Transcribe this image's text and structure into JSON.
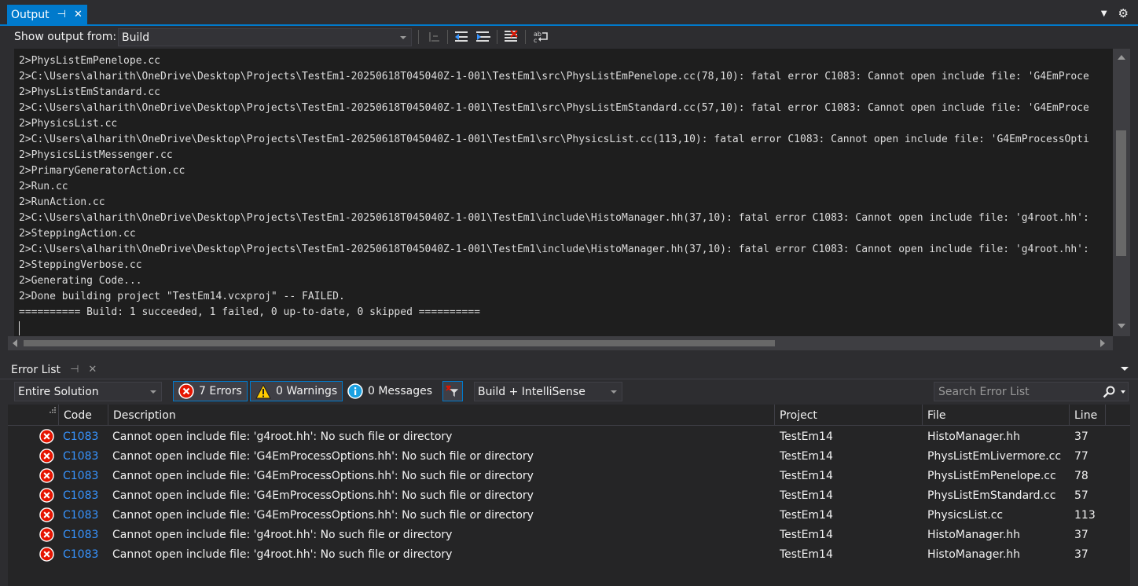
{
  "output": {
    "tab_title": "Output",
    "pin_glyph": "⊣",
    "close_glyph": "✕",
    "window_menu_glyph": "▼",
    "settings_glyph": "⚙",
    "show_output_label": "Show output from:",
    "source_value": "Build",
    "lines": [
      "2>PhysListEmPenelope.cc",
      "2>C:\\Users\\alharith\\OneDrive\\Desktop\\Projects\\TestEm1-20250618T045040Z-1-001\\TestEm1\\src\\PhysListEmPenelope.cc(78,10): fatal error C1083: Cannot open include file: 'G4EmProce",
      "2>PhysListEmStandard.cc",
      "2>C:\\Users\\alharith\\OneDrive\\Desktop\\Projects\\TestEm1-20250618T045040Z-1-001\\TestEm1\\src\\PhysListEmStandard.cc(57,10): fatal error C1083: Cannot open include file: 'G4EmProce",
      "2>PhysicsList.cc",
      "2>C:\\Users\\alharith\\OneDrive\\Desktop\\Projects\\TestEm1-20250618T045040Z-1-001\\TestEm1\\src\\PhysicsList.cc(113,10): fatal error C1083: Cannot open include file: 'G4EmProcessOpti",
      "2>PhysicsListMessenger.cc",
      "2>PrimaryGeneratorAction.cc",
      "2>Run.cc",
      "2>RunAction.cc",
      "2>C:\\Users\\alharith\\OneDrive\\Desktop\\Projects\\TestEm1-20250618T045040Z-1-001\\TestEm1\\include\\HistoManager.hh(37,10): fatal error C1083: Cannot open include file: 'g4root.hh':",
      "2>SteppingAction.cc",
      "2>C:\\Users\\alharith\\OneDrive\\Desktop\\Projects\\TestEm1-20250618T045040Z-1-001\\TestEm1\\include\\HistoManager.hh(37,10): fatal error C1083: Cannot open include file: 'g4root.hh':",
      "2>SteppingVerbose.cc",
      "2>Generating Code...",
      "2>Done building project \"TestEm14.vcxproj\" -- FAILED.",
      "========== Build: 1 succeeded, 1 failed, 0 up-to-date, 0 skipped =========="
    ]
  },
  "error_list": {
    "tab_title": "Error List",
    "pin_glyph": "⊣",
    "close_glyph": "✕",
    "scope_value": "Entire Solution",
    "errors_label": "7 Errors",
    "warnings_label": "0 Warnings",
    "messages_label": "0 Messages",
    "source_filter_value": "Build + IntelliSense",
    "search_placeholder": "Search Error List",
    "columns": {
      "code": "Code",
      "description": "Description",
      "project": "Project",
      "file": "File",
      "line": "Line"
    },
    "rows": [
      {
        "code": "C1083",
        "description": "Cannot open include file: 'g4root.hh': No such file or directory",
        "project": "TestEm14",
        "file": "HistoManager.hh",
        "line": "37"
      },
      {
        "code": "C1083",
        "description": "Cannot open include file: 'G4EmProcessOptions.hh': No such file or directory",
        "project": "TestEm14",
        "file": "PhysListEmLivermore.cc",
        "line": "77"
      },
      {
        "code": "C1083",
        "description": "Cannot open include file: 'G4EmProcessOptions.hh': No such file or directory",
        "project": "TestEm14",
        "file": "PhysListEmPenelope.cc",
        "line": "78"
      },
      {
        "code": "C1083",
        "description": "Cannot open include file: 'G4EmProcessOptions.hh': No such file or directory",
        "project": "TestEm14",
        "file": "PhysListEmStandard.cc",
        "line": "57"
      },
      {
        "code": "C1083",
        "description": "Cannot open include file: 'G4EmProcessOptions.hh': No such file or directory",
        "project": "TestEm14",
        "file": "PhysicsList.cc",
        "line": "113"
      },
      {
        "code": "C1083",
        "description": "Cannot open include file: 'g4root.hh': No such file or directory",
        "project": "TestEm14",
        "file": "HistoManager.hh",
        "line": "37"
      },
      {
        "code": "C1083",
        "description": "Cannot open include file: 'g4root.hh': No such file or directory",
        "project": "TestEm14",
        "file": "HistoManager.hh",
        "line": "37"
      }
    ]
  },
  "colors": {
    "accent": "#007acc",
    "error": "#e51400",
    "warning": "#ffcc00",
    "info": "#1ba1e2",
    "link": "#3794ff"
  },
  "icons": {
    "clear": "clear-all-icon",
    "prev": "go-to-previous-message-icon",
    "next": "go-to-next-message-icon",
    "find": "find-in-output-icon",
    "wrap": "toggle-word-wrap-icon",
    "filter": "filter-icon",
    "search": "search-icon"
  }
}
